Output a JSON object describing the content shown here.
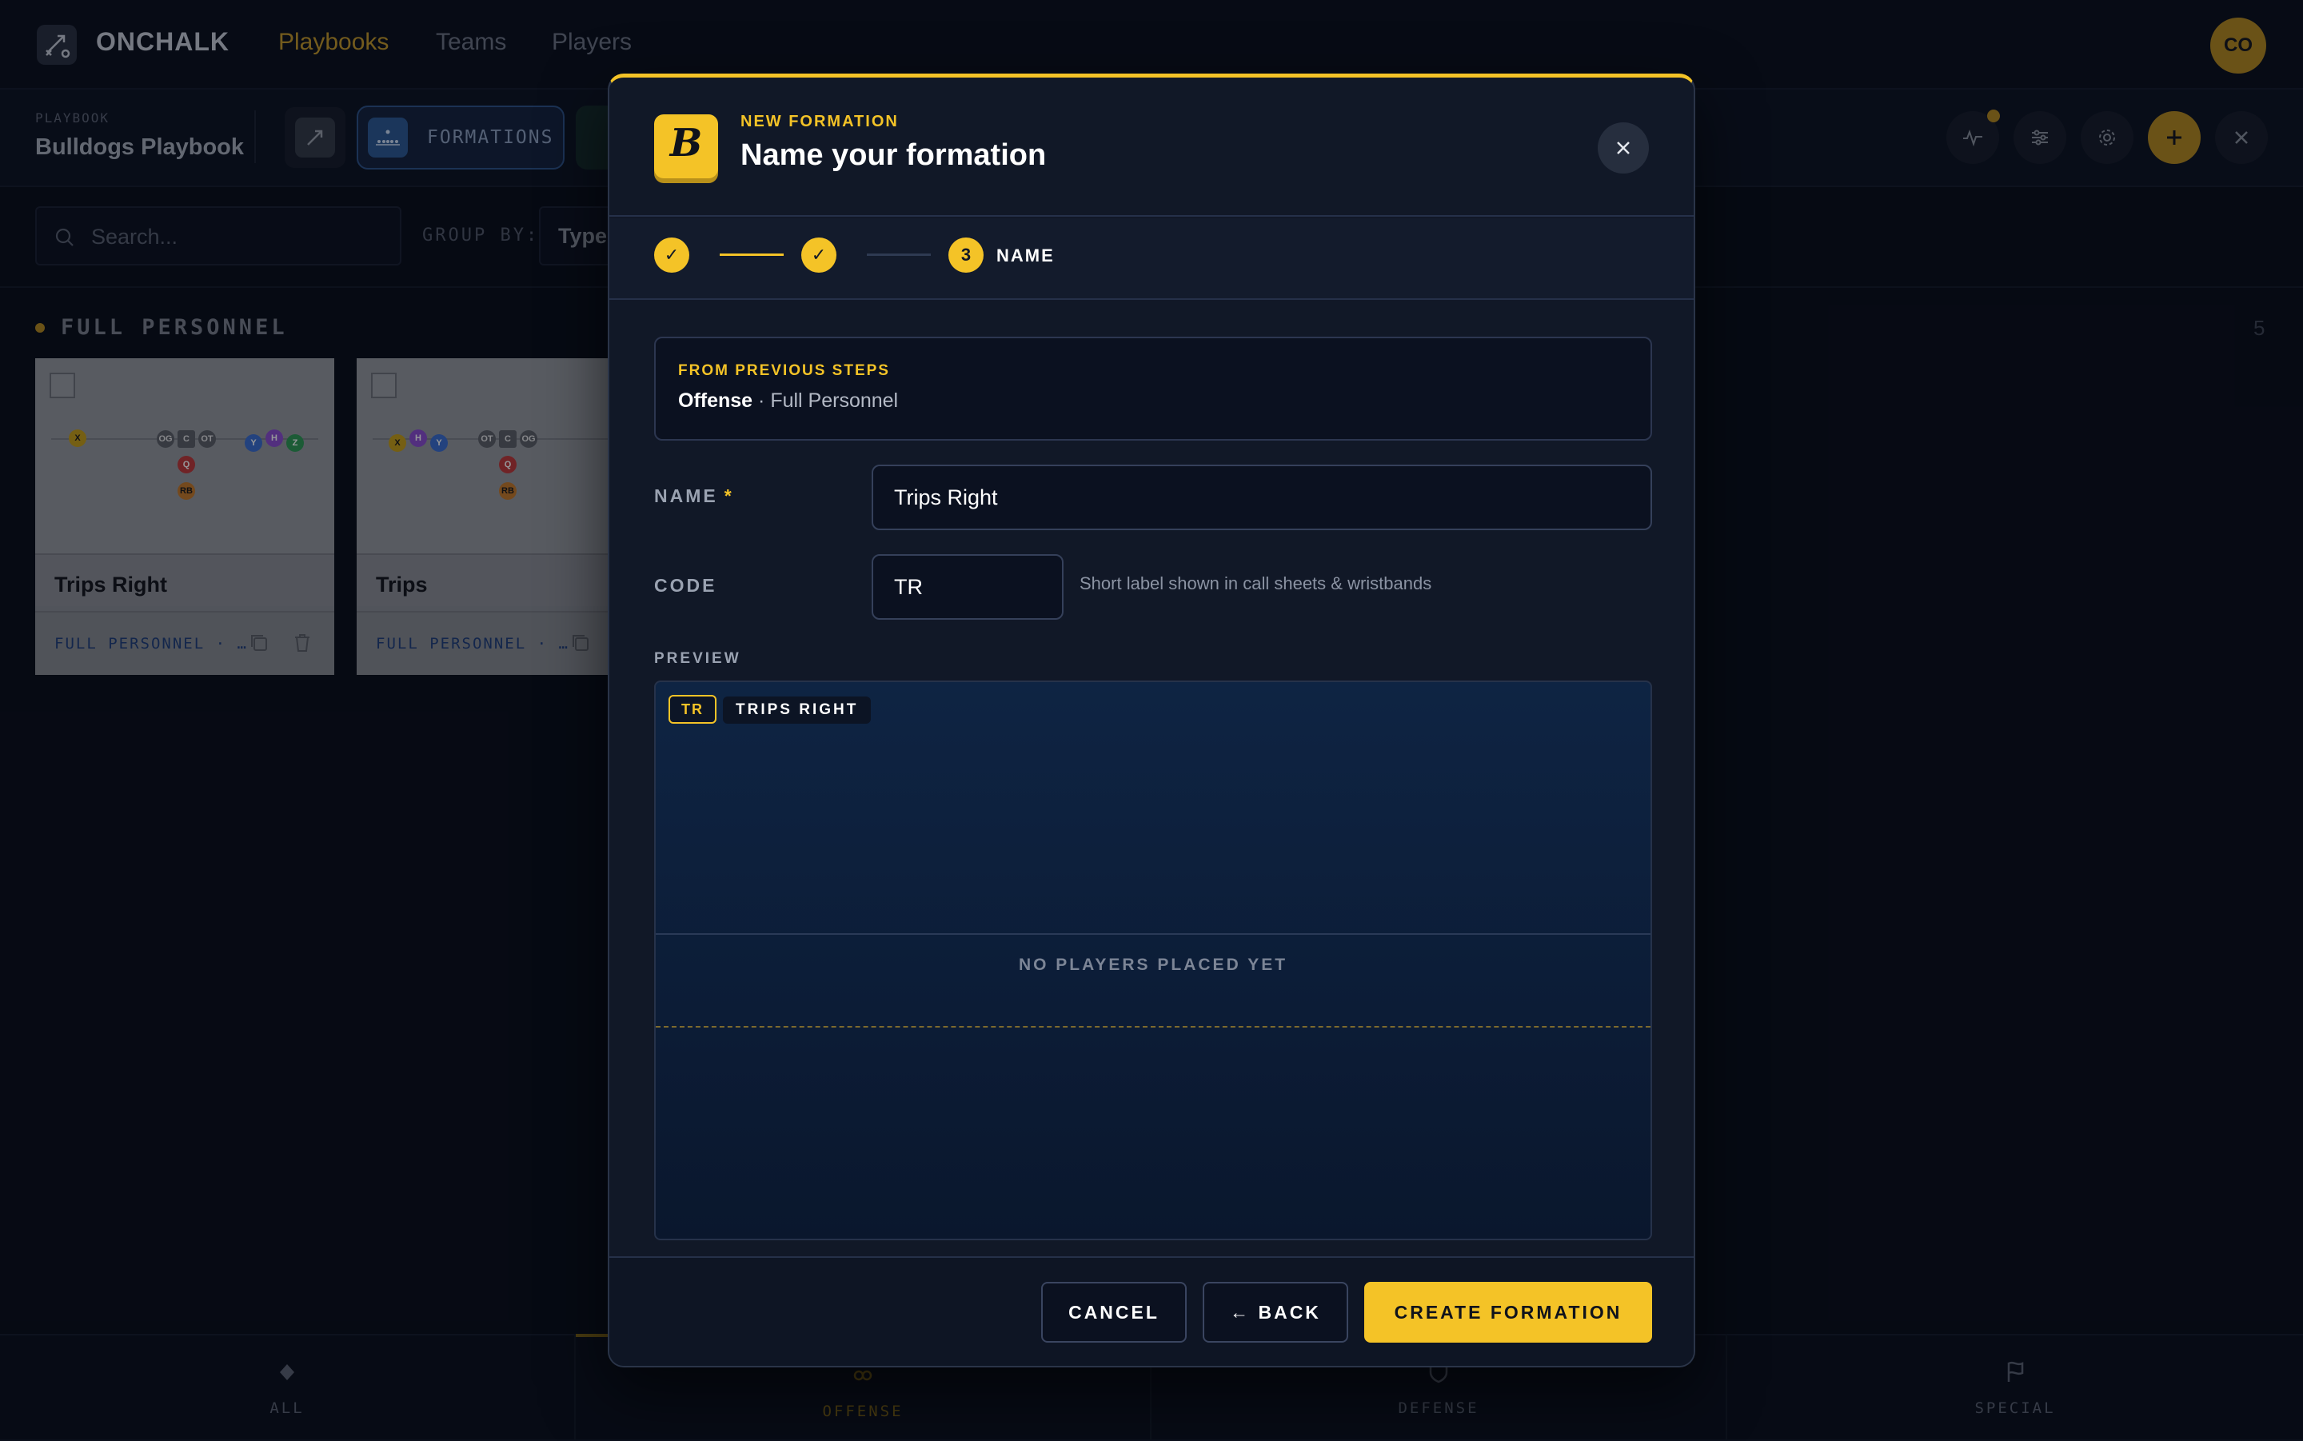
{
  "app": {
    "brand": "ONCHALK",
    "user_initials": "CO"
  },
  "nav": {
    "links": [
      "Playbooks",
      "Teams",
      "Players"
    ],
    "active": "Playbooks"
  },
  "playbook": {
    "label": "PLAYBOOK",
    "name": "Bulldogs Playbook",
    "active_tab": "FORMATIONS"
  },
  "filter": {
    "search_placeholder": "Search...",
    "group_by_label": "GROUP BY:",
    "group_by_value": "Type"
  },
  "group": {
    "title": "FULL PERSONNEL",
    "count": "5"
  },
  "cards": [
    {
      "title": "Trips Right",
      "meta": "FULL PERSONNEL · …",
      "players": [
        "X",
        "OG",
        "C",
        "OT",
        "Q",
        "RB",
        "Y",
        "H",
        "Z"
      ]
    },
    {
      "title": "Trips",
      "meta": "FULL PERSONNEL · …",
      "players": [
        "X",
        "H",
        "Y",
        "OT",
        "C",
        "OG",
        "Q",
        "RB"
      ]
    }
  ],
  "bottom_nav": [
    {
      "label": "ALL",
      "icon": "diamond-icon"
    },
    {
      "label": "OFFENSE",
      "icon": "rings-icon",
      "active": true
    },
    {
      "label": "DEFENSE",
      "icon": "shield-icon"
    },
    {
      "label": "SPECIAL",
      "icon": "flag-icon"
    }
  ],
  "modal": {
    "logo_letter": "B",
    "eyebrow": "NEW FORMATION",
    "title": "Name your formation",
    "steps": [
      {
        "mark": "✓",
        "state": "done"
      },
      {
        "mark": "✓",
        "state": "done"
      },
      {
        "mark": "3",
        "state": "current",
        "label": "NAME"
      }
    ],
    "previous": {
      "eyebrow": "FROM PREVIOUS STEPS",
      "side": "Offense",
      "separator": " · ",
      "personnel": "Full Personnel"
    },
    "name_field": {
      "label": "NAME",
      "required_mark": "*",
      "value": "Trips Right"
    },
    "code_field": {
      "label": "CODE",
      "value": "TR",
      "help": "Short label shown in call sheets & wristbands"
    },
    "preview": {
      "label": "PREVIEW",
      "code_badge": "TR",
      "name_badge": "TRIPS RIGHT",
      "empty_text": "NO PLAYERS PLACED YET"
    },
    "buttons": {
      "cancel": "CANCEL",
      "back": "← BACK",
      "create": "CREATE FORMATION"
    }
  },
  "colors": {
    "accent": "#f4c327",
    "background": "#0a0e19",
    "modal_bg": "#111827",
    "formations_tab": "#2e5a94"
  }
}
